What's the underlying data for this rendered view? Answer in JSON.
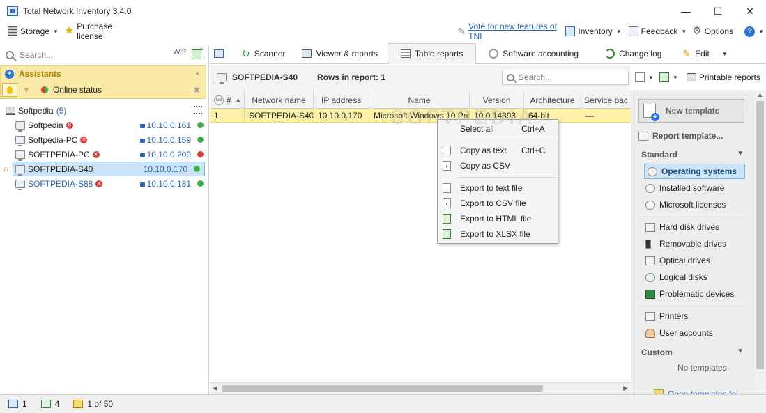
{
  "window": {
    "title": "Total Network Inventory 3.4.0",
    "minimize": "—",
    "maximize": "☐",
    "close": "✕"
  },
  "toolbar": {
    "storage": "Storage",
    "purchase": "Purchase license",
    "vote": "Vote for new features of TNI",
    "inventory": "Inventory",
    "feedback": "Feedback",
    "options": "Options",
    "help": "?"
  },
  "left": {
    "search_placeholder": "Search...",
    "sort_label": "A/IP",
    "assistants_title": "Assistants",
    "online_status": "Online status",
    "root": {
      "name": "Softpedia",
      "count": "(5)"
    },
    "nodes": [
      {
        "name": "Softpedia",
        "ip": "10.10.0.161",
        "status_color": "#3bb24a",
        "error": true
      },
      {
        "name": "Softpedia-PC",
        "ip": "10.10.0.159",
        "status_color": "#3bb24a",
        "error": true
      },
      {
        "name": "SOFTPEDIA-PC",
        "ip": "10.10.0.209",
        "status_color": "#e03b3b",
        "error": true
      },
      {
        "name": "SOFTPEDIA-S40",
        "ip": "10.10.0.170",
        "status_color": "#3bb24a",
        "error": false
      },
      {
        "name": "SOFTPEDIA-S88",
        "ip": "10.10.0.181",
        "status_color": "#3bb24a",
        "error": true
      }
    ]
  },
  "tabs": [
    {
      "label": "Scanner"
    },
    {
      "label": "Viewer & reports"
    },
    {
      "label": "Table reports"
    },
    {
      "label": "Software accounting"
    },
    {
      "label": "Change log"
    },
    {
      "label": "Edit"
    }
  ],
  "report": {
    "node": "SOFTPEDIA-S40",
    "rows_label": "Rows in report: 1",
    "search_placeholder": "Search...",
    "printable": "Printable reports",
    "columns": [
      "#",
      "Network name",
      "IP address",
      "Name",
      "Version",
      "Architecture",
      "Service pac"
    ],
    "rows": [
      [
        "1",
        "SOFTPEDIA-S40",
        "10.10.0.170",
        "Microsoft Windows 10 Pro",
        "10.0.14393",
        "64-bit",
        "—"
      ]
    ],
    "os_badge": "OS"
  },
  "context_menu": {
    "select_all": "Select all",
    "select_all_sc": "Ctrl+A",
    "copy_text": "Copy as text",
    "copy_text_sc": "Ctrl+C",
    "copy_csv": "Copy as CSV",
    "export_text": "Export to text file",
    "export_csv": "Export to CSV file",
    "export_html": "Export to HTML file",
    "export_xlsx": "Export to XLSX file"
  },
  "right": {
    "new_template": "New template",
    "report_template": "Report template...",
    "standard": "Standard",
    "standard_items": [
      "Operating systems",
      "Installed software",
      "Microsoft licenses"
    ],
    "drive_items": [
      "Hard disk drives",
      "Removable drives",
      "Optical drives",
      "Logical disks",
      "Problematic devices"
    ],
    "other_items": [
      "Printers",
      "User accounts"
    ],
    "custom": "Custom",
    "no_templates": "No templates",
    "open_folder": "Open templates fol..."
  },
  "status": {
    "computers": "1",
    "nodes": "4",
    "pages": "1 of 50"
  },
  "watermark": "SOFTPEDIA"
}
